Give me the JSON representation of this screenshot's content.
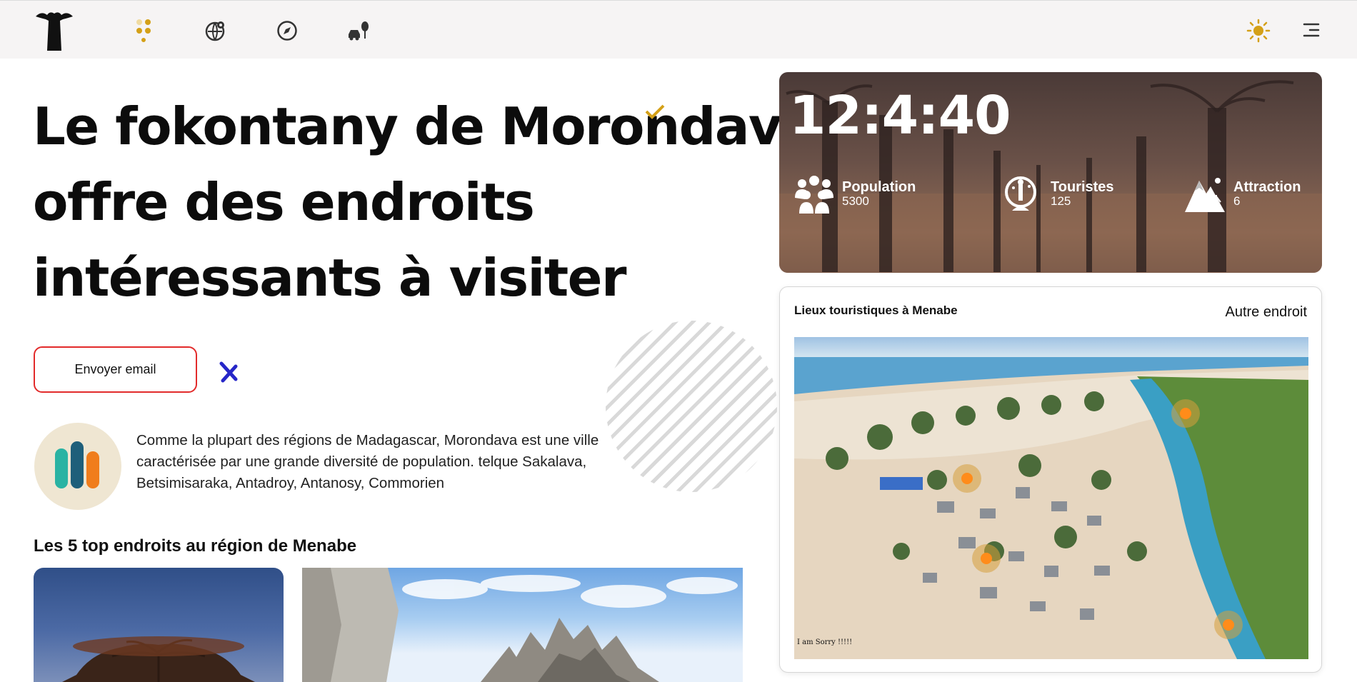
{
  "nav": {
    "logo": "baobab-logo",
    "items": [
      {
        "name": "apps",
        "icon": "dots-grid-icon"
      },
      {
        "name": "globe",
        "icon": "globe-pin-icon"
      },
      {
        "name": "compass",
        "icon": "compass-icon"
      },
      {
        "name": "car",
        "icon": "car-tree-icon"
      }
    ],
    "theme_icon": "sun-icon",
    "menu_icon": "menu-lines-icon"
  },
  "hero": {
    "line1": "Le fokontany de Morondava",
    "line2": "offre des endroits",
    "line3": "intéressants à visiter"
  },
  "cta": {
    "email_label": "Envoyer email"
  },
  "intro": {
    "text": "Comme la plupart des régions de Madagascar, Morondava est une ville caractérisée par une grande diversité de population. telque Sakalava, Betsimisaraka, Antadroy, Antanosy, Commorien"
  },
  "top_places": {
    "title": "Les 5 top endroits au région de Menabe"
  },
  "stats": {
    "clock": "12:4:40",
    "population": {
      "label": "Population",
      "value": "5300"
    },
    "tourists": {
      "label": "Touristes",
      "value": "125"
    },
    "attraction": {
      "label": "Attraction",
      "value": "6"
    }
  },
  "map": {
    "title": "Lieux touristiques à Menabe",
    "link": "Autre endroit",
    "caption": "I am Sorry !!!!!",
    "pins": 4
  },
  "colors": {
    "accent": "#d4a017",
    "button_border": "#e22b2b",
    "pin": "#ff8c1a"
  }
}
